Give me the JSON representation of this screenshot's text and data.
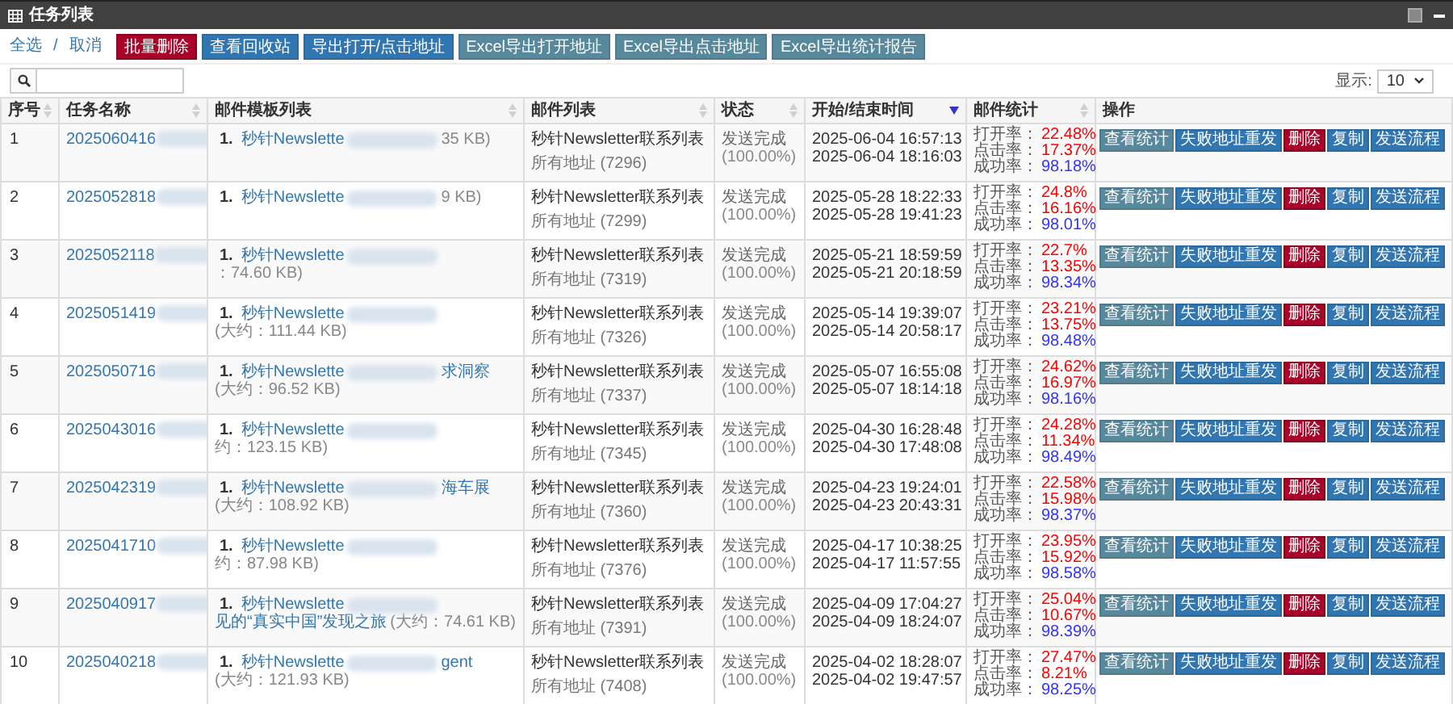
{
  "window": {
    "title": "任务列表"
  },
  "toolbar": {
    "select_all": "全选",
    "separator": "/",
    "cancel": "取消",
    "buttons": [
      {
        "label": "批量删除",
        "kind": "danger"
      },
      {
        "label": "查看回收站",
        "kind": "primary"
      },
      {
        "label": "导出打开/点击地址",
        "kind": "primary"
      },
      {
        "label": "Excel导出打开地址",
        "kind": "info"
      },
      {
        "label": "Excel导出点击地址",
        "kind": "info"
      },
      {
        "label": "Excel导出统计报告",
        "kind": "info"
      }
    ]
  },
  "page_size": {
    "label": "显示:",
    "value": "10"
  },
  "table": {
    "columns": [
      {
        "label": "序号",
        "sortable": true,
        "selected": false
      },
      {
        "label": "任务名称",
        "sortable": true,
        "selected": false
      },
      {
        "label": "邮件模板列表",
        "sortable": true,
        "selected": false
      },
      {
        "label": "邮件列表",
        "sortable": true,
        "selected": false
      },
      {
        "label": "状态",
        "sortable": true,
        "selected": false
      },
      {
        "label": "开始/结束时间",
        "sortable": true,
        "selected": true
      },
      {
        "label": "邮件统计",
        "sortable": true,
        "selected": false
      },
      {
        "label": "操作"
      }
    ],
    "rows": [
      {
        "no": "1",
        "task": "2025060416",
        "template": {
          "index": "1.",
          "name_start": "秒针Newslette",
          "size": "35 KB)"
        },
        "list": {
          "name": "秒针Newsletter联系列表",
          "count": "所有地址 (7296)"
        },
        "status": {
          "text": "发送完成",
          "percent": "(100.00%)"
        },
        "start": "2025-06-04 16:57:13",
        "end": "2025-06-04 18:16:03",
        "stats": {
          "open_label": "打开率：",
          "open": "22.48%",
          "click_label": "点击率：",
          "click": "17.37%",
          "success_label": "成功率：",
          "success": "98.18%"
        },
        "actions": [
          {
            "label": "查看统计",
            "kind": "info"
          },
          {
            "label": "失败地址重发",
            "kind": "primary"
          },
          {
            "label": "删除",
            "kind": "danger"
          },
          {
            "label": "复制",
            "kind": "primary"
          },
          {
            "label": "发送流程",
            "kind": "primary"
          }
        ]
      },
      {
        "no": "2",
        "task": "2025052818",
        "template": {
          "index": "1.",
          "name_start": "秒针Newslette",
          "size": "9 KB)"
        },
        "list": {
          "name": "秒针Newsletter联系列表",
          "count": "所有地址 (7299)"
        },
        "status": {
          "text": "发送完成",
          "percent": "(100.00%)"
        },
        "start": "2025-05-28 18:22:33",
        "end": "2025-05-28 19:41:23",
        "stats": {
          "open_label": "打开率：",
          "open": "24.8%",
          "click_label": "点击率：",
          "click": "16.16%",
          "success_label": "成功率：",
          "success": "98.01%"
        },
        "actions": [
          {
            "label": "查看统计",
            "kind": "info"
          },
          {
            "label": "失败地址重发",
            "kind": "primary"
          },
          {
            "label": "删除",
            "kind": "danger"
          },
          {
            "label": "复制",
            "kind": "primary"
          },
          {
            "label": "发送流程",
            "kind": "primary"
          }
        ]
      },
      {
        "no": "3",
        "task": "2025052118",
        "template": {
          "index": "1.",
          "name_start": "秒针Newslette",
          "size": "：74.60 KB)"
        },
        "list": {
          "name": "秒针Newsletter联系列表",
          "count": "所有地址 (7319)"
        },
        "status": {
          "text": "发送完成",
          "percent": "(100.00%)"
        },
        "start": "2025-05-21 18:59:59",
        "end": "2025-05-21 20:18:59",
        "stats": {
          "open_label": "打开率：",
          "open": "22.7%",
          "click_label": "点击率：",
          "click": "13.35%",
          "success_label": "成功率：",
          "success": "98.34%"
        },
        "actions": [
          {
            "label": "查看统计",
            "kind": "info"
          },
          {
            "label": "失败地址重发",
            "kind": "primary"
          },
          {
            "label": "删除",
            "kind": "danger"
          },
          {
            "label": "复制",
            "kind": "primary"
          },
          {
            "label": "发送流程",
            "kind": "primary"
          }
        ]
      },
      {
        "no": "4",
        "task": "2025051419",
        "template": {
          "index": "1.",
          "name_start": "秒针Newslette",
          "size": "(大约：111.44 KB)"
        },
        "list": {
          "name": "秒针Newsletter联系列表",
          "count": "所有地址 (7326)"
        },
        "status": {
          "text": "发送完成",
          "percent": "(100.00%)"
        },
        "start": "2025-05-14 19:39:07",
        "end": "2025-05-14 20:58:17",
        "stats": {
          "open_label": "打开率：",
          "open": "23.21%",
          "click_label": "点击率：",
          "click": "13.75%",
          "success_label": "成功率：",
          "success": "98.48%"
        },
        "actions": [
          {
            "label": "查看统计",
            "kind": "info"
          },
          {
            "label": "失败地址重发",
            "kind": "primary"
          },
          {
            "label": "删除",
            "kind": "danger"
          },
          {
            "label": "复制",
            "kind": "primary"
          },
          {
            "label": "发送流程",
            "kind": "primary"
          }
        ]
      },
      {
        "no": "5",
        "task": "2025050716",
        "template": {
          "index": "1.",
          "name_start": "秒针Newslette",
          "name_end": "求洞察",
          "size": "(大约：96.52 KB)"
        },
        "list": {
          "name": "秒针Newsletter联系列表",
          "count": "所有地址 (7337)"
        },
        "status": {
          "text": "发送完成",
          "percent": "(100.00%)"
        },
        "start": "2025-05-07 16:55:08",
        "end": "2025-05-07 18:14:18",
        "stats": {
          "open_label": "打开率：",
          "open": "24.62%",
          "click_label": "点击率：",
          "click": "16.97%",
          "success_label": "成功率：",
          "success": "98.16%"
        },
        "actions": [
          {
            "label": "查看统计",
            "kind": "info"
          },
          {
            "label": "失败地址重发",
            "kind": "primary"
          },
          {
            "label": "删除",
            "kind": "danger"
          },
          {
            "label": "复制",
            "kind": "primary"
          },
          {
            "label": "发送流程",
            "kind": "primary"
          }
        ]
      },
      {
        "no": "6",
        "task": "2025043016",
        "template": {
          "index": "1.",
          "name_start": "秒针Newslette",
          "size": "约：123.15 KB)"
        },
        "list": {
          "name": "秒针Newsletter联系列表",
          "count": "所有地址 (7345)"
        },
        "status": {
          "text": "发送完成",
          "percent": "(100.00%)"
        },
        "start": "2025-04-30 16:28:48",
        "end": "2025-04-30 17:48:08",
        "stats": {
          "open_label": "打开率：",
          "open": "24.28%",
          "click_label": "点击率：",
          "click": "11.34%",
          "success_label": "成功率：",
          "success": "98.49%"
        },
        "actions": [
          {
            "label": "查看统计",
            "kind": "info"
          },
          {
            "label": "失败地址重发",
            "kind": "primary"
          },
          {
            "label": "删除",
            "kind": "danger"
          },
          {
            "label": "复制",
            "kind": "primary"
          },
          {
            "label": "发送流程",
            "kind": "primary"
          }
        ]
      },
      {
        "no": "7",
        "task": "2025042319",
        "template": {
          "index": "1.",
          "name_start": "秒针Newslette",
          "name_end": "海车展",
          "size": "(大约：108.92 KB)"
        },
        "list": {
          "name": "秒针Newsletter联系列表",
          "count": "所有地址 (7360)"
        },
        "status": {
          "text": "发送完成",
          "percent": "(100.00%)"
        },
        "start": "2025-04-23 19:24:01",
        "end": "2025-04-23 20:43:31",
        "stats": {
          "open_label": "打开率：",
          "open": "22.58%",
          "click_label": "点击率：",
          "click": "15.98%",
          "success_label": "成功率：",
          "success": "98.37%"
        },
        "actions": [
          {
            "label": "查看统计",
            "kind": "info"
          },
          {
            "label": "失败地址重发",
            "kind": "primary"
          },
          {
            "label": "删除",
            "kind": "danger"
          },
          {
            "label": "复制",
            "kind": "primary"
          },
          {
            "label": "发送流程",
            "kind": "primary"
          }
        ]
      },
      {
        "no": "8",
        "task": "2025041710",
        "template": {
          "index": "1.",
          "name_start": "秒针Newslette",
          "size": "约：87.98 KB)"
        },
        "list": {
          "name": "秒针Newsletter联系列表",
          "count": "所有地址 (7376)"
        },
        "status": {
          "text": "发送完成",
          "percent": "(100.00%)"
        },
        "start": "2025-04-17 10:38:25",
        "end": "2025-04-17 11:57:55",
        "stats": {
          "open_label": "打开率：",
          "open": "23.95%",
          "click_label": "点击率：",
          "click": "15.92%",
          "success_label": "成功率：",
          "success": "98.58%"
        },
        "actions": [
          {
            "label": "查看统计",
            "kind": "info"
          },
          {
            "label": "失败地址重发",
            "kind": "primary"
          },
          {
            "label": "删除",
            "kind": "danger"
          },
          {
            "label": "复制",
            "kind": "primary"
          },
          {
            "label": "发送流程",
            "kind": "primary"
          }
        ]
      },
      {
        "no": "9",
        "task": "2025040917",
        "template": {
          "index": "1.",
          "name_start": "秒针Newslette",
          "name_end": "见的“真实中国”发现之旅",
          "size": "(大约：74.61 KB)"
        },
        "list": {
          "name": "秒针Newsletter联系列表",
          "count": "所有地址 (7391)"
        },
        "status": {
          "text": "发送完成",
          "percent": "(100.00%)"
        },
        "start": "2025-04-09 17:04:27",
        "end": "2025-04-09 18:24:07",
        "stats": {
          "open_label": "打开率：",
          "open": "25.04%",
          "click_label": "点击率：",
          "click": "10.67%",
          "success_label": "成功率：",
          "success": "98.39%"
        },
        "actions": [
          {
            "label": "查看统计",
            "kind": "info"
          },
          {
            "label": "失败地址重发",
            "kind": "primary"
          },
          {
            "label": "删除",
            "kind": "danger"
          },
          {
            "label": "复制",
            "kind": "primary"
          },
          {
            "label": "发送流程",
            "kind": "primary"
          }
        ]
      },
      {
        "no": "10",
        "task": "2025040218",
        "template": {
          "index": "1.",
          "name_start": "秒针Newslette",
          "name_end": "gent",
          "size": "(大约：121.93 KB)"
        },
        "list": {
          "name": "秒针Newsletter联系列表",
          "count": "所有地址 (7408)"
        },
        "status": {
          "text": "发送完成",
          "percent": "(100.00%)"
        },
        "start": "2025-04-02 18:28:07",
        "end": "2025-04-02 19:47:57",
        "stats": {
          "open_label": "打开率：",
          "open": "27.47%",
          "click_label": "点击率：",
          "click": "8.21%",
          "success_label": "成功率：",
          "success": "98.25%"
        },
        "actions": [
          {
            "label": "查看统计",
            "kind": "info"
          },
          {
            "label": "失败地址重发",
            "kind": "primary"
          },
          {
            "label": "删除",
            "kind": "danger"
          },
          {
            "label": "复制",
            "kind": "primary"
          },
          {
            "label": "发送流程",
            "kind": "primary"
          }
        ]
      }
    ]
  }
}
